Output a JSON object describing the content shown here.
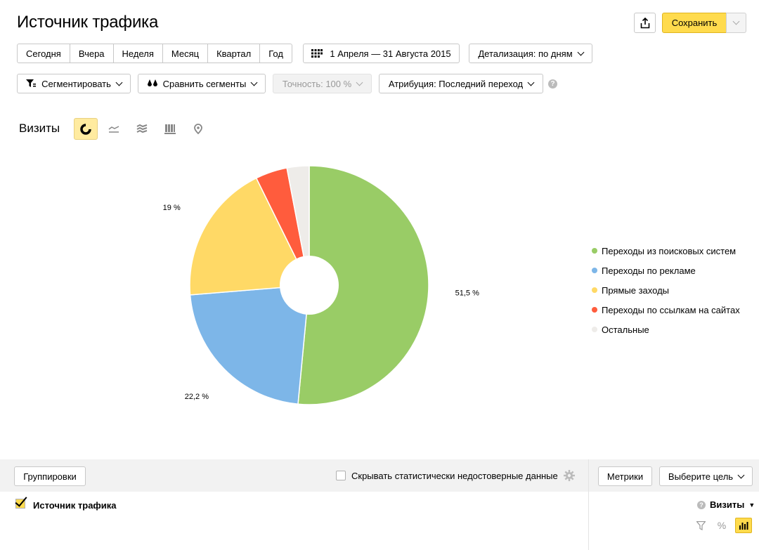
{
  "header": {
    "title": "Источник трафика",
    "save_label": "Сохранить",
    "share_icon": "share-icon",
    "dropdown_icon": "chevron-down-icon"
  },
  "periods": [
    "Сегодня",
    "Вчера",
    "Неделя",
    "Месяц",
    "Квартал",
    "Год"
  ],
  "date_range": "1 Апреля — 31 Августа 2015",
  "detail_label": "Детализация: по дням",
  "segment_label": "Сегментировать",
  "compare_label": "Сравнить сегменты",
  "accuracy_label": "Точность:  100 %",
  "attribution_label": "Атрибуция: Последний переход",
  "visits_label": "Визиты",
  "chart_types": [
    "pie-chart-icon",
    "line-chart-icon",
    "area-chart-icon",
    "bar-chart-icon",
    "map-icon"
  ],
  "chart_data": {
    "type": "pie",
    "donut": true,
    "series": [
      {
        "name": "Переходы из поисковых систем",
        "value": 51.5,
        "label": "51,5 %",
        "color": "#99cc66"
      },
      {
        "name": "Переходы по рекламе",
        "value": 22.2,
        "label": "22,2 %",
        "color": "#7db6e8"
      },
      {
        "name": "Прямые заходы",
        "value": 19,
        "label": "19 %",
        "color": "#ffd966"
      },
      {
        "name": "Переходы по ссылкам на сайтах",
        "value": 4.3,
        "label": "",
        "color": "#ff5c3d"
      },
      {
        "name": "Остальные",
        "value": 3.0,
        "label": "",
        "color": "#eeece9"
      }
    ],
    "legend_position": "right"
  },
  "bottom": {
    "groupings_label": "Группировки",
    "hide_label": "Скрывать статистически недостоверные данные",
    "metrics_label": "Метрики",
    "goal_label": "Выберите цель",
    "row_label": "Источник трафика",
    "metric_col": "Визиты"
  }
}
